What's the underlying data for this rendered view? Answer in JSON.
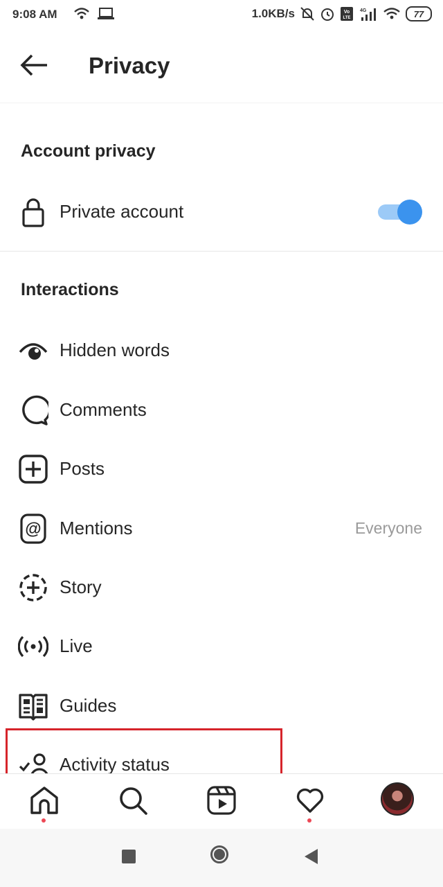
{
  "status_bar": {
    "time": "9:08 AM",
    "net_speed": "1.0KB/s",
    "battery": "77",
    "network_type": "4G",
    "volte": "Vo LTE"
  },
  "header": {
    "title": "Privacy",
    "back_icon": "arrow-left-icon"
  },
  "account_privacy": {
    "heading": "Account privacy",
    "private_account": {
      "label": "Private account",
      "icon": "lock-icon",
      "enabled": true
    }
  },
  "interactions": {
    "heading": "Interactions",
    "items": [
      {
        "label": "Hidden words",
        "icon": "eye-icon",
        "value": ""
      },
      {
        "label": "Comments",
        "icon": "comment-bubble-icon",
        "value": ""
      },
      {
        "label": "Posts",
        "icon": "plus-square-icon",
        "value": ""
      },
      {
        "label": "Mentions",
        "icon": "at-sign-icon",
        "value": "Everyone"
      },
      {
        "label": "Story",
        "icon": "story-plus-icon",
        "value": ""
      },
      {
        "label": "Live",
        "icon": "live-broadcast-icon",
        "value": ""
      },
      {
        "label": "Guides",
        "icon": "guides-book-icon",
        "value": ""
      },
      {
        "label": "Activity status",
        "icon": "activity-status-icon",
        "value": ""
      }
    ]
  },
  "tab_bar": {
    "tabs": [
      "home-icon",
      "search-icon",
      "reels-icon",
      "heart-icon",
      "profile-avatar"
    ]
  },
  "colors": {
    "accent": "#3b93ee",
    "highlight": "#d6242b",
    "notification_dot": "#ed4956"
  }
}
